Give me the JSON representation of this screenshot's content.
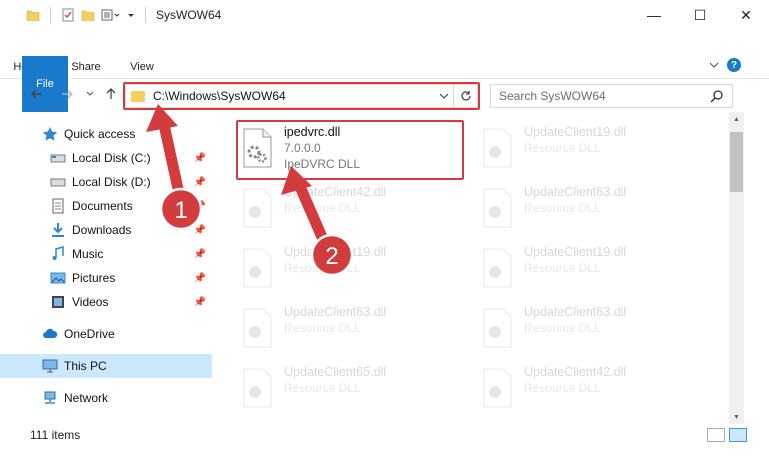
{
  "window": {
    "title": "SysWOW64",
    "minimize": "—",
    "maximize": "☐",
    "close": "✕"
  },
  "ribbon": {
    "tabs": [
      "File",
      "Home",
      "Share",
      "View"
    ],
    "help": "?"
  },
  "navigation": {
    "address": "C:\\Windows\\SysWOW64",
    "search_placeholder": "Search SysWOW64"
  },
  "sidebar": {
    "items": [
      {
        "label": "Quick access",
        "icon": "star-icon"
      },
      {
        "label": "Local Disk (C:)",
        "icon": "drive-icon",
        "pinned": true
      },
      {
        "label": "Local Disk (D:)",
        "icon": "drive-icon",
        "pinned": true
      },
      {
        "label": "Documents",
        "icon": "documents-icon",
        "pinned": true
      },
      {
        "label": "Downloads",
        "icon": "downloads-icon",
        "pinned": true
      },
      {
        "label": "Music",
        "icon": "music-icon",
        "pinned": true
      },
      {
        "label": "Pictures",
        "icon": "pictures-icon",
        "pinned": true
      },
      {
        "label": "Videos",
        "icon": "videos-icon",
        "pinned": true
      },
      {
        "label": "OneDrive",
        "icon": "cloud-icon"
      },
      {
        "label": "This PC",
        "icon": "computer-icon",
        "selected": true
      },
      {
        "label": "Network",
        "icon": "network-icon"
      }
    ]
  },
  "files": [
    {
      "name": "ipedvrc.dll",
      "version": "7.0.0.0",
      "description": "IpeDVRC DLL",
      "highlighted": true
    },
    {
      "name": "UpdateClient19.dll",
      "description": "Resource DLL"
    },
    {
      "name": "UpdateClient42.dll",
      "description": "Resource DLL"
    },
    {
      "name": "UpdateClient63.dll",
      "description": "Resource DLL"
    },
    {
      "name": "UpdateClient19.dll",
      "description": "Resource DLL"
    },
    {
      "name": "UpdateClient19.dll",
      "description": "Resource DLL"
    },
    {
      "name": "UpdateClient63.dll",
      "description": "Resource DLL"
    },
    {
      "name": "UpdateClient63.dll",
      "description": "Resource DLL"
    },
    {
      "name": "UpdateClient65.dll",
      "description": "Resource DLL"
    },
    {
      "name": "UpdateClient42.dll",
      "description": "Resource DLL"
    }
  ],
  "status": {
    "item_count": "111 items"
  },
  "annotations": {
    "badge1": "1",
    "badge2": "2",
    "color": "#d23c3c"
  }
}
